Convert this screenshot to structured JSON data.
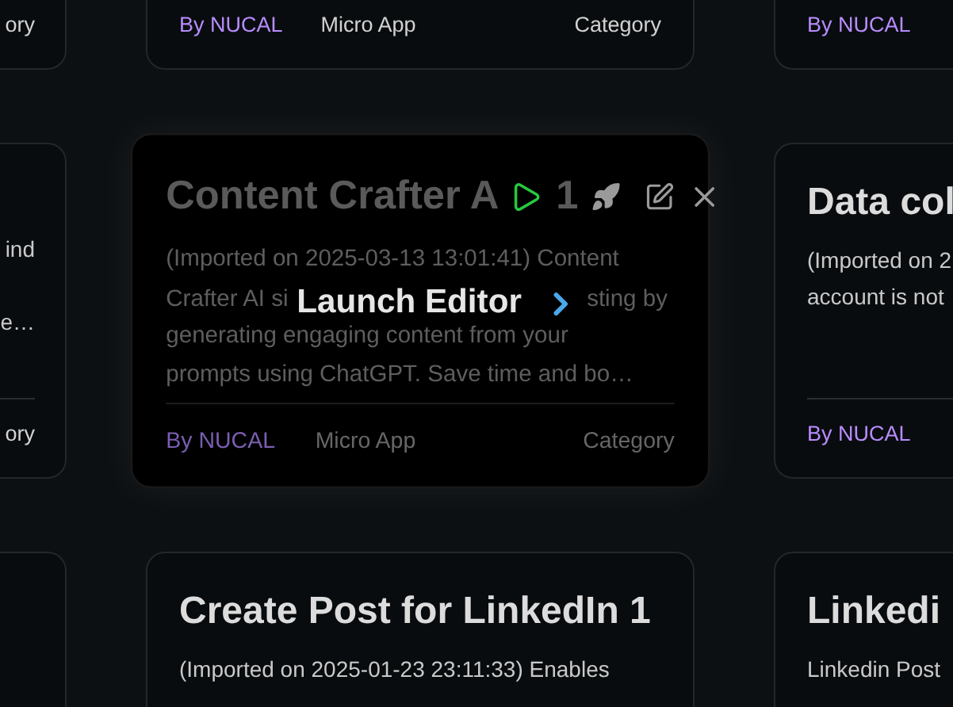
{
  "rows": [
    {
      "cards": [
        {
          "kind": "left-edge",
          "category": "ory"
        },
        {
          "kind": "full",
          "hovered": false,
          "author": "By NUCAL",
          "type": "Micro App",
          "category": "Category"
        },
        {
          "kind": "right-edge",
          "author": "By NUCAL"
        }
      ]
    },
    {
      "cards": [
        {
          "kind": "left-edge",
          "description_lines": [
            "ind",
            "e…"
          ],
          "category": "ory"
        },
        {
          "kind": "full",
          "hovered": true,
          "title": "Content Crafter A",
          "title_tail": "1",
          "description_lines": [
            "(Imported on 2025-03-13 13:01:41) Content",
            "generating engaging content from your",
            "prompts using ChatGPT. Save time and bo…"
          ],
          "overlay": {
            "left": "Crafter AI si",
            "label": "Launch Editor",
            "right": "sting by"
          },
          "author": "By NUCAL",
          "type": "Micro App",
          "category": "Category"
        },
        {
          "kind": "right-edge",
          "title": "Data col",
          "description_lines": [
            "(Imported on 2",
            "account is not"
          ],
          "author": "By NUCAL"
        }
      ]
    },
    {
      "cards": [
        {
          "kind": "left-edge"
        },
        {
          "kind": "full",
          "hovered": false,
          "title": "Create Post for LinkedIn 1",
          "description": "(Imported on 2025-01-23 23:11:33) Enables"
        },
        {
          "kind": "right-edge",
          "title": "Linkedi",
          "description_lines": [
            "Linkedin Post"
          ]
        }
      ]
    }
  ]
}
